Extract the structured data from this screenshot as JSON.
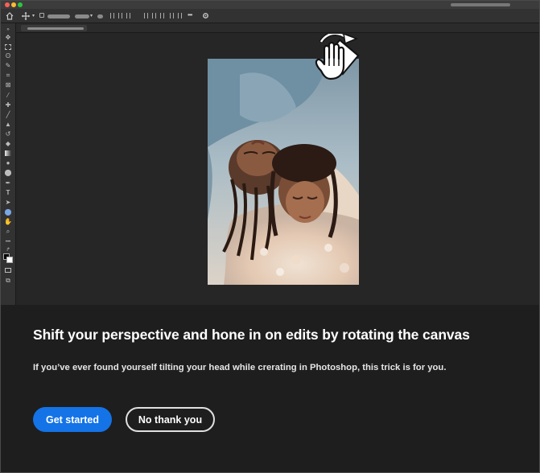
{
  "colors": {
    "accent": "#1473e6",
    "panel_bg": "#1e1e1e",
    "canvas_bg": "#262626"
  },
  "titlebar": {
    "traffic_lights": [
      "close",
      "minimize",
      "zoom"
    ]
  },
  "optionsbar": {
    "icons": [
      "home-icon",
      "move-tool-icon",
      "align-icons",
      "more-icon",
      "gear-icon"
    ],
    "more_label": "•••"
  },
  "toolbar": {
    "type_tool_label": "T",
    "tools": [
      "move",
      "marquee",
      "lasso",
      "quick-select",
      "crop",
      "frame",
      "eyedropper",
      "healing",
      "brush",
      "stamp",
      "history-brush",
      "eraser",
      "gradient",
      "blur",
      "dodge",
      "pen",
      "type",
      "path-select",
      "shape",
      "hand",
      "zoom",
      "more"
    ]
  },
  "canvas": {
    "cursor": "rotate-view-cursor"
  },
  "onboarding": {
    "title": "Shift your perspective and hone in on edits by rotating the canvas",
    "body": "If you’ve ever found yourself tilting your head while crerating in Photoshop, this trick is for you.",
    "primary_button": "Get started",
    "secondary_button": "No thank you"
  }
}
